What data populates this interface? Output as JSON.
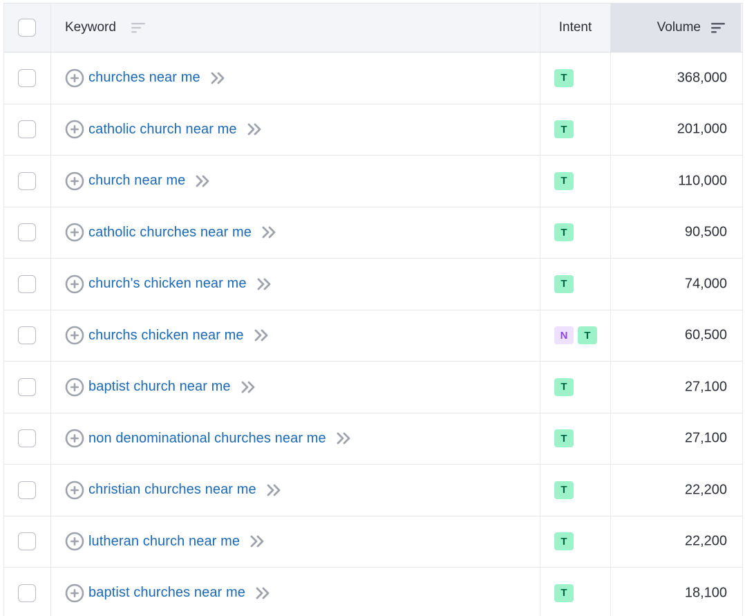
{
  "header": {
    "keyword_label": "Keyword",
    "intent_label": "Intent",
    "volume_label": "Volume"
  },
  "colors": {
    "link": "#1b68b5",
    "transactional_badge_bg": "#9ef2c9",
    "navigational_badge_bg": "#ede1ff"
  },
  "rows": [
    {
      "keyword": "churches near me",
      "intents": [
        "T"
      ],
      "volume": "368,000"
    },
    {
      "keyword": "catholic church near me",
      "intents": [
        "T"
      ],
      "volume": "201,000"
    },
    {
      "keyword": "church near me",
      "intents": [
        "T"
      ],
      "volume": "110,000"
    },
    {
      "keyword": "catholic churches near me",
      "intents": [
        "T"
      ],
      "volume": "90,500"
    },
    {
      "keyword": "church's chicken near me",
      "intents": [
        "T"
      ],
      "volume": "74,000"
    },
    {
      "keyword": "churchs chicken near me",
      "intents": [
        "N",
        "T"
      ],
      "volume": "60,500"
    },
    {
      "keyword": "baptist church near me",
      "intents": [
        "T"
      ],
      "volume": "27,100"
    },
    {
      "keyword": "non denominational churches near me",
      "intents": [
        "T"
      ],
      "volume": "27,100"
    },
    {
      "keyword": "christian churches near me",
      "intents": [
        "T"
      ],
      "volume": "22,200"
    },
    {
      "keyword": "lutheran church near me",
      "intents": [
        "T"
      ],
      "volume": "22,200"
    },
    {
      "keyword": "baptist churches near me",
      "intents": [
        "T"
      ],
      "volume": "18,100"
    }
  ]
}
